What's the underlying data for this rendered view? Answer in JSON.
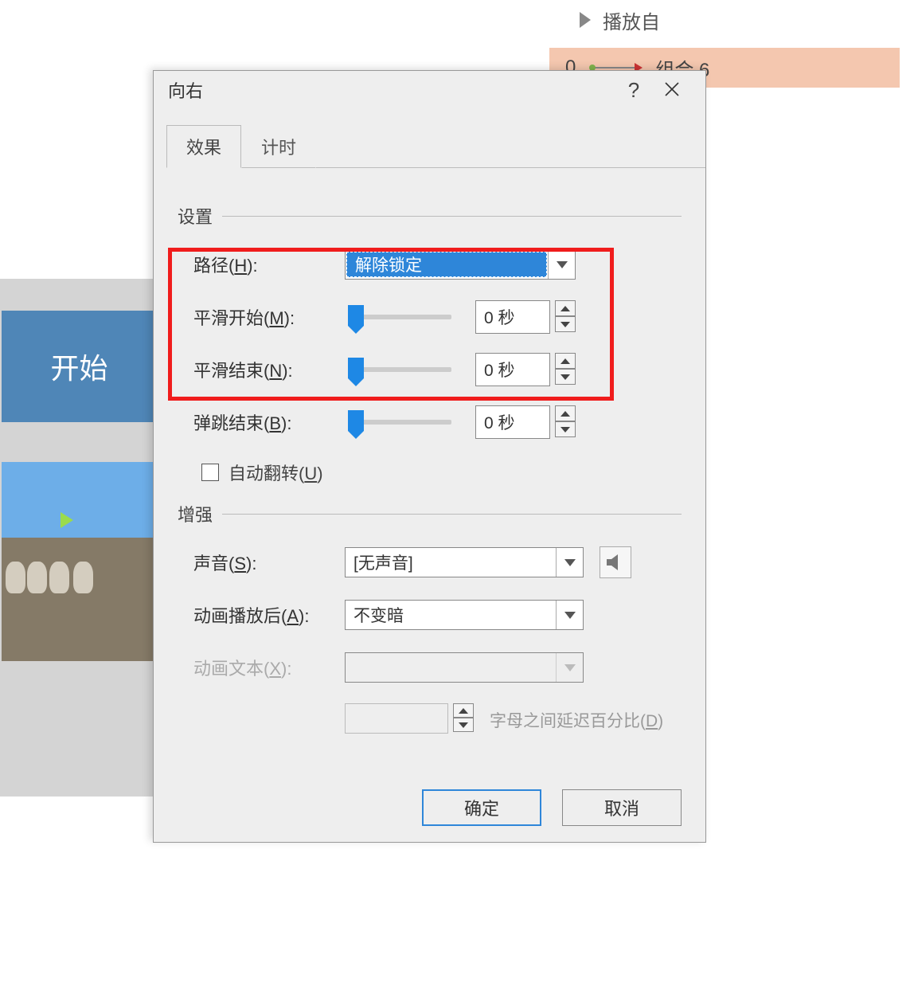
{
  "background": {
    "slide_start_label": "开始",
    "anim_pane_item1": "播放自",
    "anim_pane_item2_index": "0",
    "anim_pane_item2_name": "组合 6"
  },
  "dialog": {
    "title": "向右",
    "help": "?",
    "tabs": {
      "effect": "效果",
      "timing": "计时"
    },
    "group_settings": "设置",
    "group_enhance": "增强",
    "path_label_pre": "路径(",
    "path_hotkey": "H",
    "path_label_post": "):",
    "path_value": "解除锁定",
    "smooth_start_pre": "平滑开始(",
    "smooth_start_hotkey": "M",
    "smooth_start_post": "):",
    "smooth_start_value": "0 秒",
    "smooth_end_pre": "平滑结束(",
    "smooth_end_hotkey": "N",
    "smooth_end_post": "):",
    "smooth_end_value": "0 秒",
    "bounce_end_pre": "弹跳结束(",
    "bounce_end_hotkey": "B",
    "bounce_end_post": "):",
    "bounce_end_value": "0 秒",
    "auto_reverse_pre": "自动翻转(",
    "auto_reverse_hotkey": "U",
    "auto_reverse_post": ")",
    "sound_pre": "声音(",
    "sound_hotkey": "S",
    "sound_post": "):",
    "sound_value": "[无声音]",
    "after_anim_pre": "动画播放后(",
    "after_anim_hotkey": "A",
    "after_anim_post": "):",
    "after_anim_value": "不变暗",
    "anim_text_pre": "动画文本(",
    "anim_text_hotkey": "X",
    "anim_text_post": "):",
    "anim_text_value": "",
    "delay_value": "",
    "delay_label_pre": "字母之间延迟百分比(",
    "delay_hotkey": "D",
    "delay_label_post": ")",
    "ok": "确定",
    "cancel": "取消"
  }
}
